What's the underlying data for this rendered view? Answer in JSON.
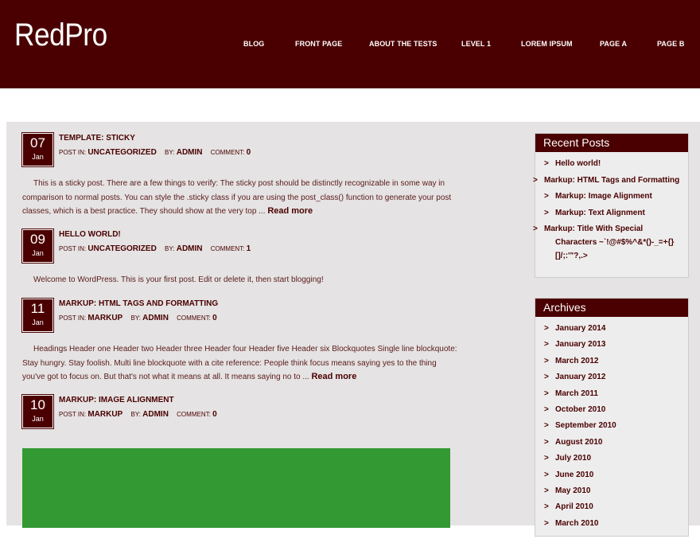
{
  "site": {
    "title": "RedPro"
  },
  "nav": [
    "BLOG",
    "FRONT PAGE",
    "ABOUT THE TESTS",
    "LEVEL 1",
    "LOREM IPSUM",
    "PAGE A",
    "PAGE B"
  ],
  "meta_labels": {
    "posted_in": "POST IN:",
    "by": "BY:",
    "comment": "COMMENT:"
  },
  "posts": [
    {
      "day": "07",
      "month": "Jan",
      "title": "TEMPLATE: STICKY",
      "category": "UNCATEGORIZED",
      "author": "ADMIN",
      "comments": "0",
      "excerpt": "This is a sticky post. There are a few things to verify: The sticky post should be distinctly recognizable in some way in comparison to normal posts. You can style the .sticky class if you are using the post_class() function to generate your post classes, which is a best practice. They should show at the very top ...",
      "more": "Read more"
    },
    {
      "day": "09",
      "month": "Jan",
      "title": "HELLO WORLD!",
      "category": "UNCATEGORIZED",
      "author": "ADMIN",
      "comments": "1",
      "excerpt": "Welcome to WordPress. This is your first post. Edit or delete it, then start blogging!",
      "more": ""
    },
    {
      "day": "11",
      "month": "Jan",
      "title": "MARKUP: HTML TAGS AND FORMATTING",
      "category": "MARKUP",
      "author": "ADMIN",
      "comments": "0",
      "excerpt": "Headings Header one Header two Header three Header four Header five Header six Blockquotes Single line blockquote: Stay hungry. Stay foolish. Multi line blockquote with a cite reference: People think focus means saying yes to the thing you've got to focus on. But that's not what it means at all. It means saying no to ...",
      "more": "Read more"
    },
    {
      "day": "10",
      "month": "Jan",
      "title": "MARKUP: IMAGE ALIGNMENT",
      "category": "MARKUP",
      "author": "ADMIN",
      "comments": "0",
      "excerpt": "",
      "more": ""
    }
  ],
  "recent_posts": {
    "title": "Recent Posts",
    "items": [
      "Hello world!",
      "Markup: HTML Tags and Formatting",
      "Markup: Image Alignment",
      "Markup: Text Alignment",
      "Markup: Title With Special Characters ~`!@#$%^&*()-_=+{}[]/;:'\"?,.>"
    ]
  },
  "archives": {
    "title": "Archives",
    "items": [
      "January 2014",
      "January 2013",
      "March 2012",
      "January 2012",
      "March 2011",
      "October 2010",
      "September 2010",
      "August 2010",
      "July 2010",
      "June 2010",
      "May 2010",
      "April 2010",
      "March 2010"
    ]
  },
  "colors": {
    "brand": "#4a0000",
    "content_bg": "#e5e3e3",
    "image_green": "#339933"
  }
}
